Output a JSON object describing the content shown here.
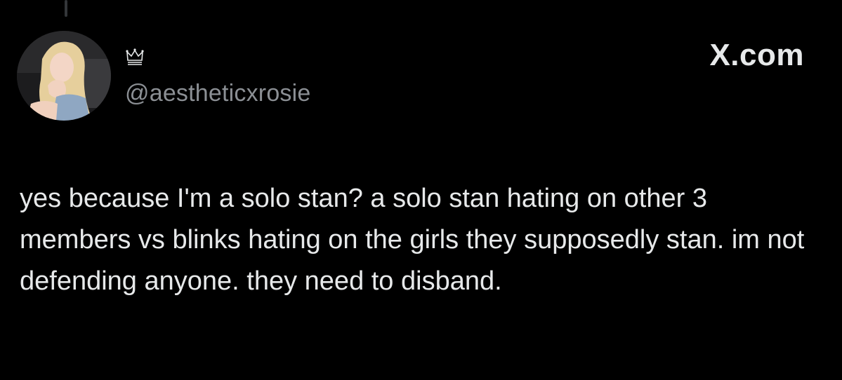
{
  "tweet": {
    "display_name_icon": "crown-icon",
    "handle": "@aestheticxrosie",
    "site": "X.com",
    "text": "yes because I'm a solo stan? a solo stan hating on other 3 members vs blinks hating on the girls they supposedly stan. im not defending anyone. they need to disband."
  },
  "colors": {
    "background": "#000000",
    "text": "#e7e9ea",
    "secondary_text": "#8b8f94"
  }
}
